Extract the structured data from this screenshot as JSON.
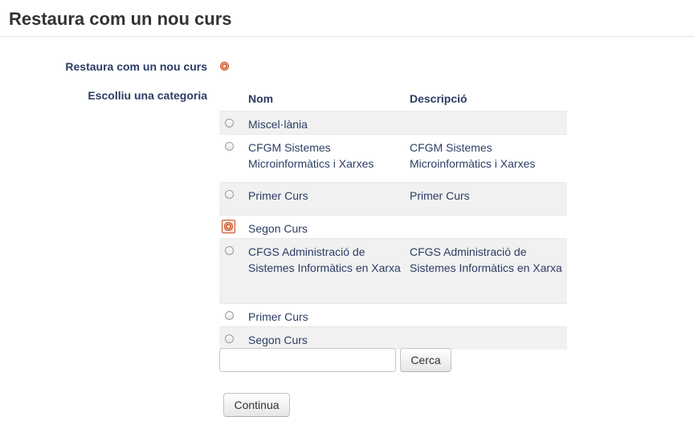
{
  "page": {
    "title": "Restaura com un nou curs"
  },
  "form": {
    "restore_label": "Restaura com un nou curs",
    "restore_selected": true,
    "category_label": "Escolliu una categoria"
  },
  "category_table": {
    "columns": [
      "Nom",
      "Descripció"
    ],
    "rows": [
      {
        "name": "Miscel·lània",
        "description": "",
        "selected": false
      },
      {
        "name": "CFGM Sistemes Microinformàtics i Xarxes",
        "description": "CFGM Sistemes Microinformàtics i Xarxes",
        "selected": false
      },
      {
        "name": "Primer Curs",
        "description": "Primer Curs",
        "selected": false
      },
      {
        "name": "Segon Curs",
        "description": "",
        "selected": true
      },
      {
        "name": "CFGS Administració de Sistemes Informàtics en Xarxa",
        "description": "CFGS Administració de Sistemes Informàtics en Xarxa",
        "selected": false
      },
      {
        "name": "Primer Curs",
        "description": "",
        "selected": false
      },
      {
        "name": "Segon Curs",
        "description": "",
        "selected": false
      }
    ]
  },
  "search": {
    "value": "",
    "placeholder": "",
    "button_label": "Cerca"
  },
  "actions": {
    "continue_label": "Continua"
  },
  "colors": {
    "label_text": "#2c3d64",
    "radio_checked": "#d4532a",
    "row_stripe": "#f1f1f1"
  }
}
